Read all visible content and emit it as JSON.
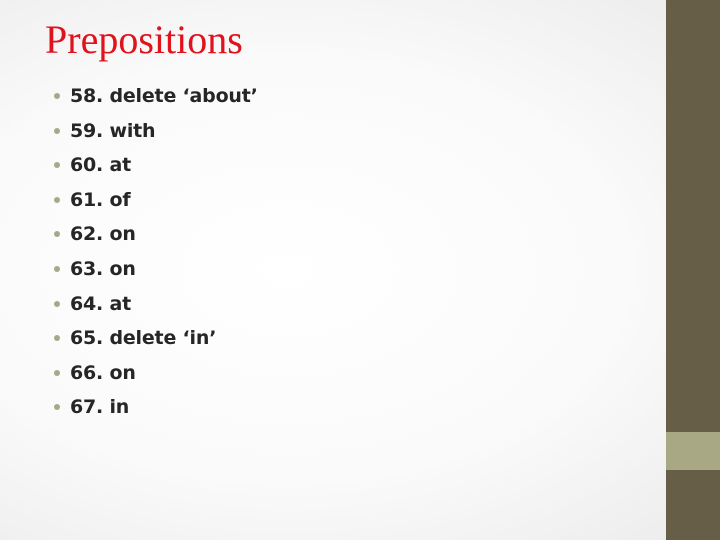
{
  "slide": {
    "title": "Prepositions",
    "items": [
      {
        "text": "58. delete ‘about’"
      },
      {
        "text": "59. with"
      },
      {
        "text": "60. at"
      },
      {
        "text": "61. of"
      },
      {
        "text": "62. on"
      },
      {
        "text": "63. on"
      },
      {
        "text": "64. at"
      },
      {
        "text": "65. delete ‘in’"
      },
      {
        "text": "66. on"
      },
      {
        "text": "67. in"
      }
    ]
  },
  "theme": {
    "title_color": "#e0121b",
    "text_color": "#262626",
    "bullet_color": "#a8a888",
    "sidebar_color": "#665e46",
    "sidebar_accent_color": "#a9a885"
  }
}
